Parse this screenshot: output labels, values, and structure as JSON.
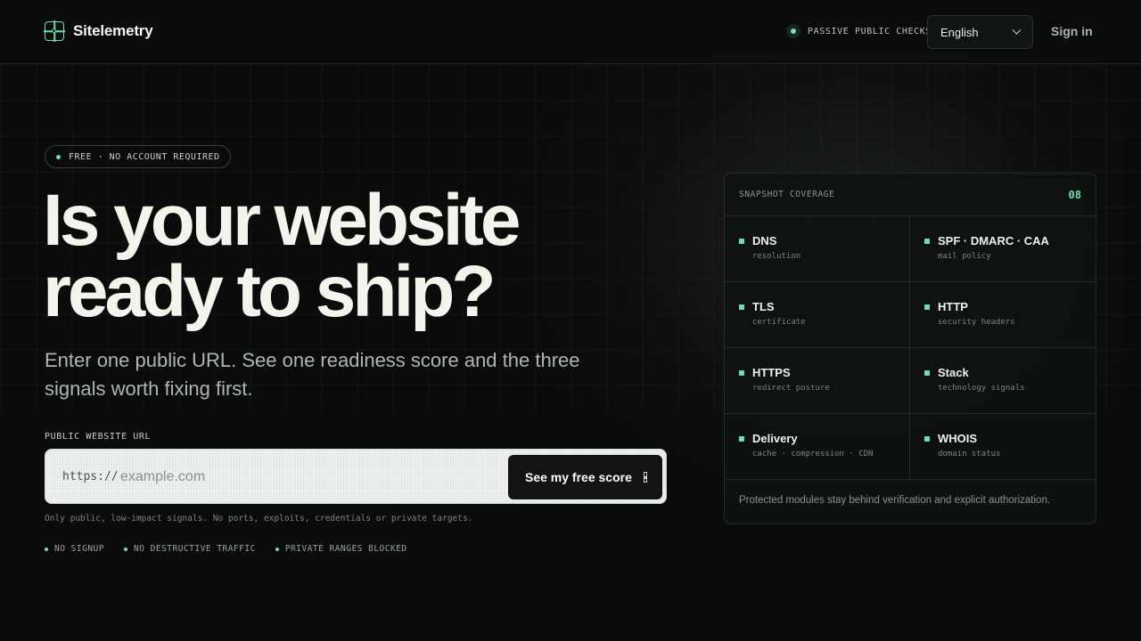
{
  "header": {
    "brand": "Sitelemetry",
    "status": "PASSIVE PUBLIC CHECKS",
    "language": "English",
    "signin": "Sign in"
  },
  "hero": {
    "pill": "FREE · NO ACCOUNT REQUIRED",
    "headline_line1": "Is your website",
    "headline_line2": "ready to ship?",
    "subtitle": "Enter one public URL. See one readiness score and the three signals worth fixing first.",
    "url_label": "PUBLIC WEBSITE URL",
    "url_prefix": "https://",
    "url_placeholder": "example.com",
    "cta": "See my free score",
    "disclaimer": "Only public, low-impact signals. No ports, exploits, credentials or private targets.",
    "badges": [
      "NO SIGNUP",
      "NO DESTRUCTIVE TRAFFIC",
      "PRIVATE RANGES BLOCKED"
    ]
  },
  "coverage": {
    "title": "SNAPSHOT COVERAGE",
    "count": "08",
    "items": [
      {
        "title": "DNS",
        "sub": "resolution"
      },
      {
        "title": "SPF · DMARC · CAA",
        "sub": "mail policy"
      },
      {
        "title": "TLS",
        "sub": "certificate"
      },
      {
        "title": "HTTP",
        "sub": "security headers"
      },
      {
        "title": "HTTPS",
        "sub": "redirect posture"
      },
      {
        "title": "Stack",
        "sub": "technology signals"
      },
      {
        "title": "Delivery",
        "sub": "cache · compression · CDN"
      },
      {
        "title": "WHOIS",
        "sub": "domain status"
      }
    ],
    "footer": "Protected modules stay behind verification and explicit authorization."
  },
  "colors": {
    "accent": "#6fe0b2",
    "background": "#0a0c0b"
  }
}
